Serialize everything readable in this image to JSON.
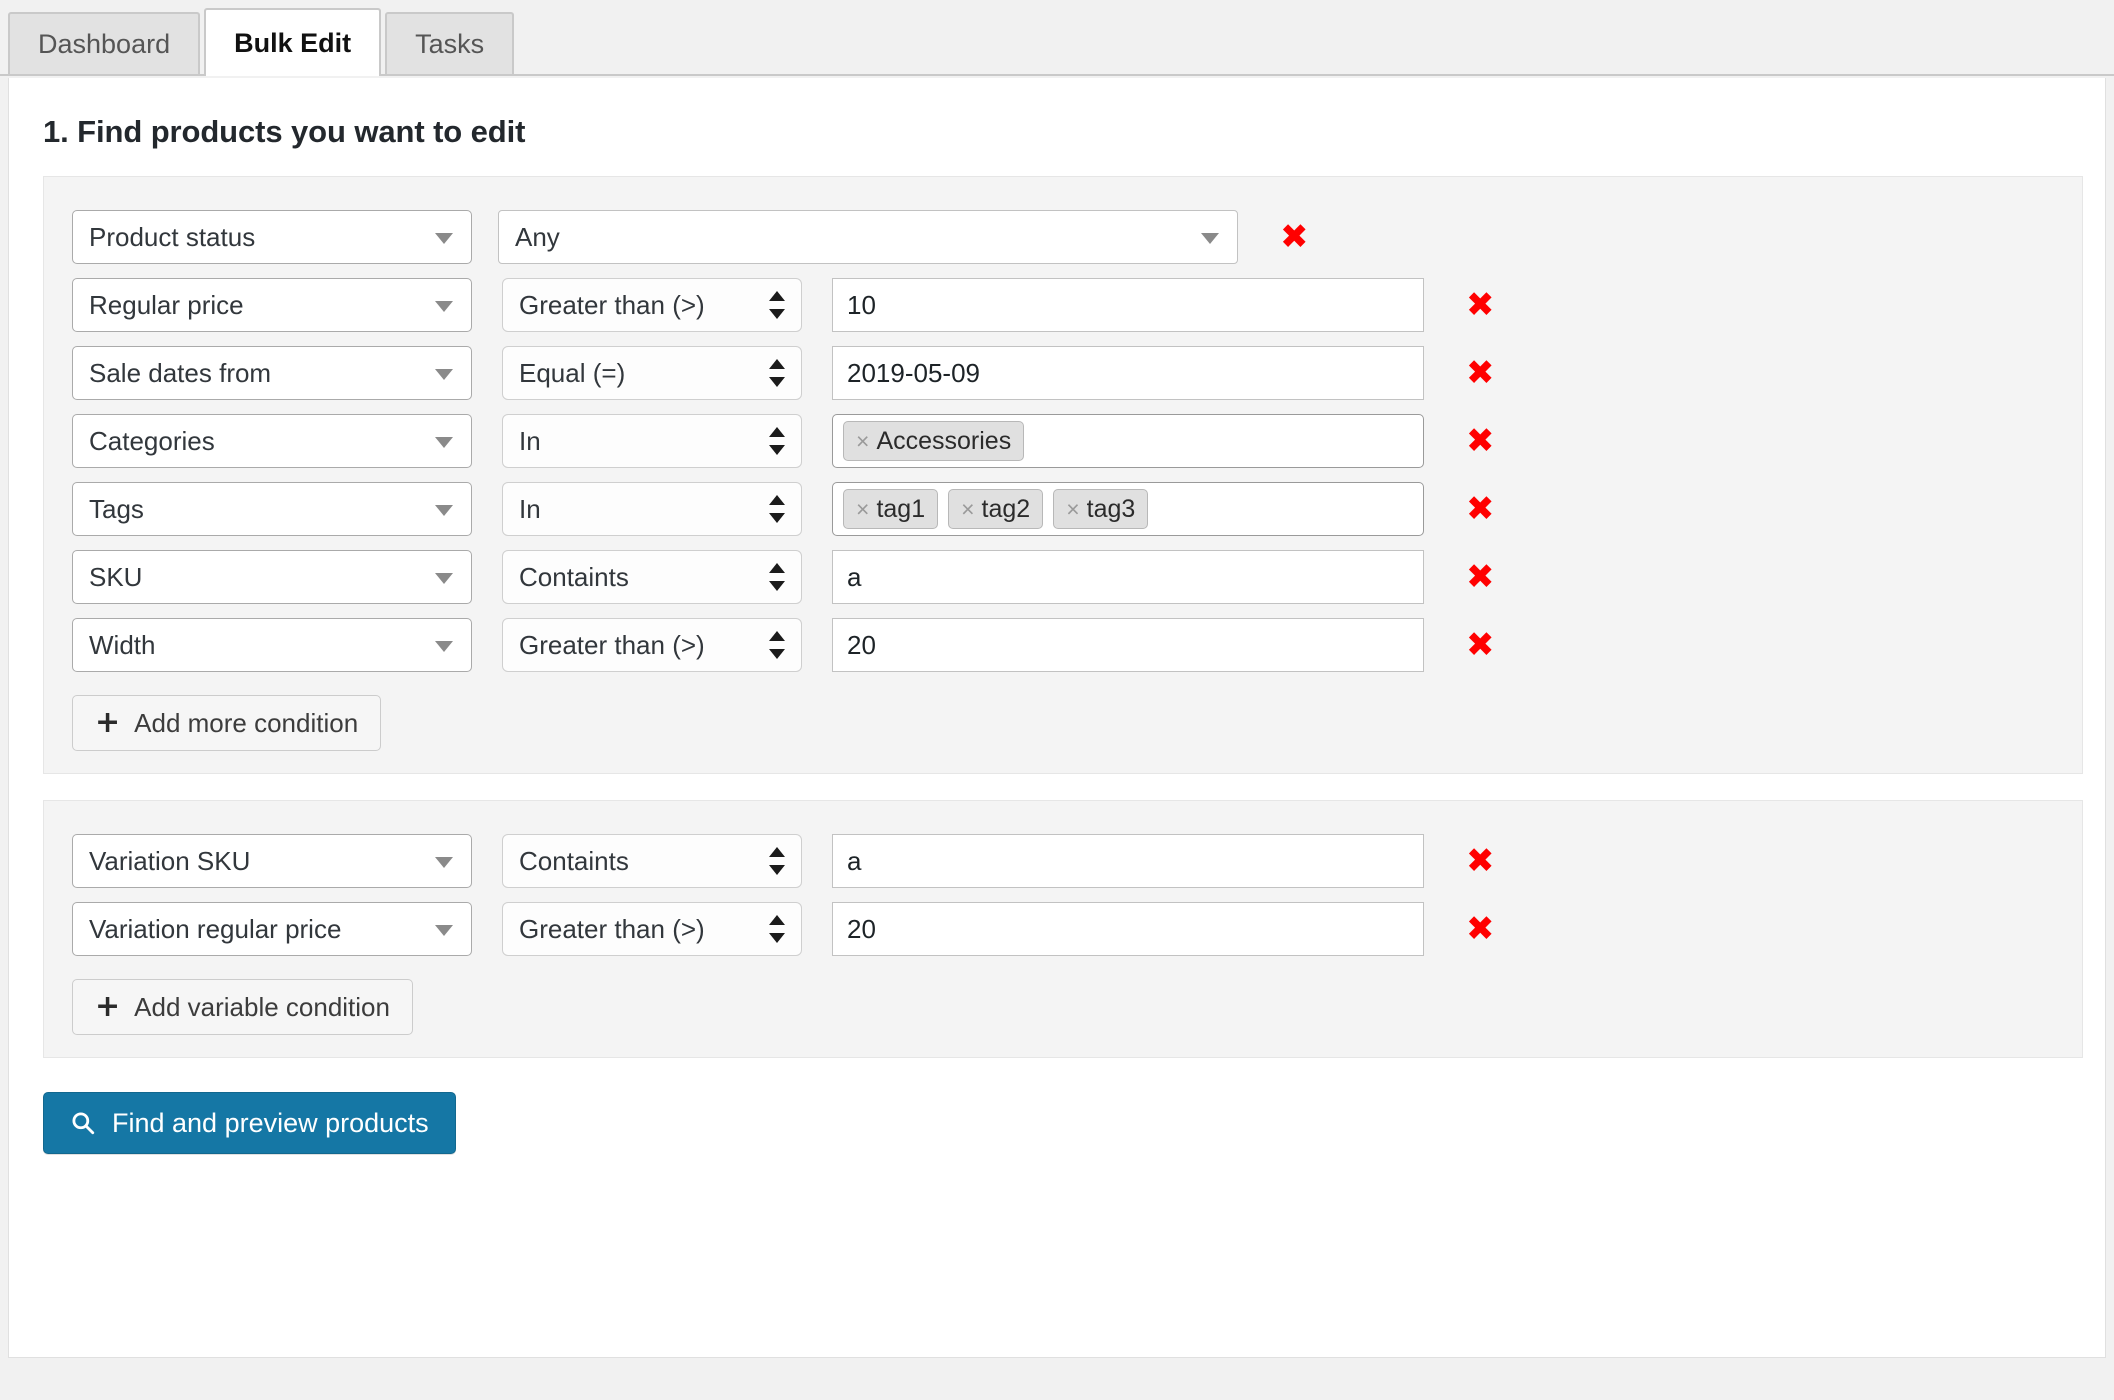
{
  "tabs": [
    {
      "label": "Dashboard",
      "active": false
    },
    {
      "label": "Bulk Edit",
      "active": true
    },
    {
      "label": "Tasks",
      "active": false
    }
  ],
  "section": {
    "title": "1. Find products you want to edit"
  },
  "icons": {
    "caret_down": "chevron-down-icon",
    "spinner": "select-spinner-icon",
    "remove": "remove-condition-icon",
    "plus": "plus-icon",
    "search": "search-icon",
    "chip_remove": "chip-remove-icon"
  },
  "colors": {
    "remove": "#ff0000",
    "primary_button": "#1577a5",
    "panel_background": "#ffffff",
    "group_background": "#f4f4f4",
    "page_background": "#f1f1f1"
  },
  "product_conditions": [
    {
      "field": "Product status",
      "operator": "",
      "value_type": "select",
      "value": "Any",
      "remove": "✖"
    },
    {
      "field": "Regular price",
      "operator": "Greater than (>)",
      "value_type": "text",
      "value": "10",
      "remove": "✖"
    },
    {
      "field": "Sale dates from",
      "operator": "Equal (=)",
      "value_type": "text",
      "value": "2019-05-09",
      "remove": "✖"
    },
    {
      "field": "Categories",
      "operator": "In",
      "value_type": "chips",
      "chips": [
        "Accessories"
      ],
      "remove": "✖"
    },
    {
      "field": "Tags",
      "operator": "In",
      "value_type": "chips",
      "chips": [
        "tag1",
        "tag2",
        "tag3"
      ],
      "remove": "✖"
    },
    {
      "field": "SKU",
      "operator": "Containts",
      "value_type": "text",
      "value": "a",
      "remove": "✖"
    },
    {
      "field": "Width",
      "operator": "Greater than (>)",
      "value_type": "text",
      "value": "20",
      "remove": "✖"
    }
  ],
  "add_condition_button": {
    "plus": "+",
    "label": "Add more condition"
  },
  "variation_conditions": [
    {
      "field": "Variation SKU",
      "operator": "Containts",
      "value_type": "text",
      "value": "a",
      "remove": "✖"
    },
    {
      "field": "Variation regular price",
      "operator": "Greater than (>)",
      "value_type": "text",
      "value": "20",
      "remove": "✖"
    }
  ],
  "add_variable_button": {
    "plus": "+",
    "label": "Add variable condition"
  },
  "find_button": {
    "label": "Find and preview products"
  },
  "chip_remove_glyph": "×"
}
